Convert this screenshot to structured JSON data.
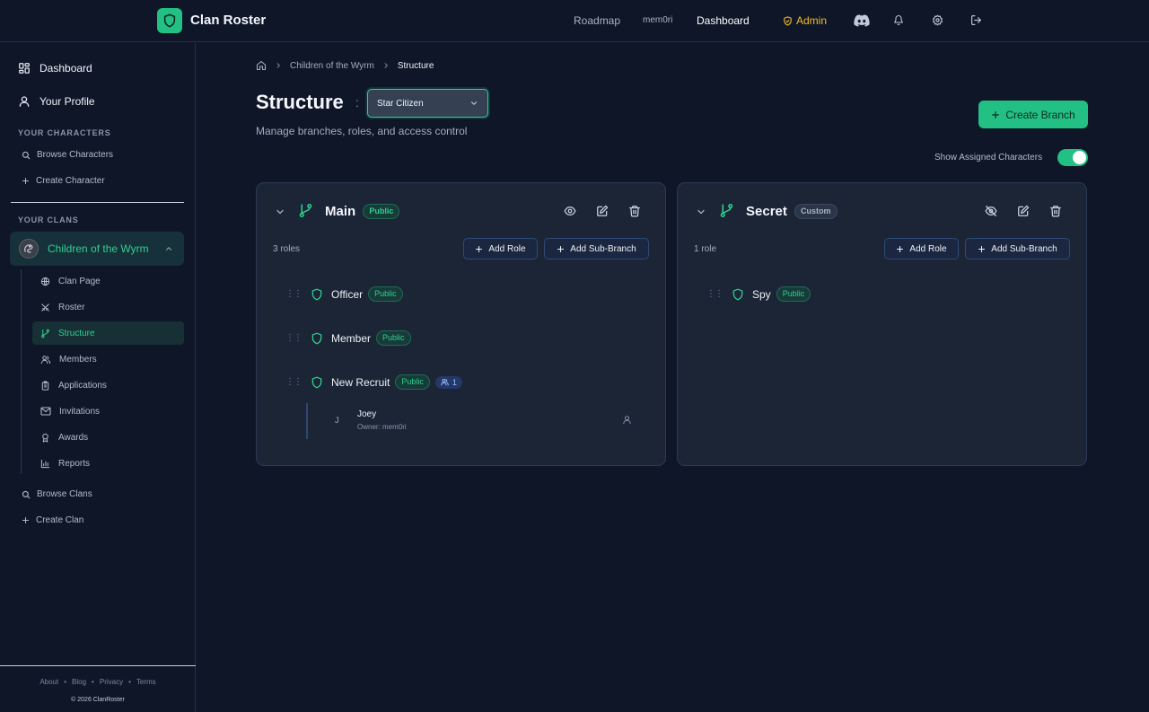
{
  "header": {
    "brand": "Clan Roster",
    "nav": {
      "roadmap": "Roadmap",
      "user": "mem0ri",
      "dashboard": "Dashboard",
      "admin": "Admin"
    },
    "icons": [
      "discord-icon",
      "bell-icon",
      "gear-icon",
      "logout-icon"
    ],
    "accent": "#22c083",
    "admin_color": "#f4bc2a"
  },
  "sidebar": {
    "dashboard": "Dashboard",
    "profile": "Your Profile",
    "characters_section": "YOUR CHARACTERS",
    "browse_characters": "Browse Characters",
    "create_character": "Create Character",
    "clans_section": "YOUR CLANS",
    "clan_name": "Children of the Wyrm",
    "clan_items": [
      "Clan Page",
      "Roster",
      "Structure",
      "Members",
      "Applications",
      "Invitations",
      "Awards",
      "Reports"
    ],
    "active_item": "Structure",
    "browse_clans": "Browse Clans",
    "create_clan": "Create Clan",
    "footer_links": [
      "About",
      "Blog",
      "Privacy",
      "Terms"
    ],
    "copyright": "© 2026 ClanRoster"
  },
  "breadcrumb": {
    "clan": "Children of the Wyrm",
    "current": "Structure"
  },
  "page": {
    "title": "Structure",
    "separator": ":",
    "game_select": "Star Citizen",
    "subtitle": "Manage branches, roles, and access control",
    "create_branch": "Create Branch",
    "toggle_label": "Show Assigned Characters",
    "toggle_on": true
  },
  "branches": [
    {
      "name": "Main",
      "visibility": "Public",
      "role_count": "3 roles",
      "add_role": "Add Role",
      "add_sub_branch": "Add Sub-Branch",
      "roles": [
        {
          "name": "Officer",
          "badge": "Public"
        },
        {
          "name": "Member",
          "badge": "Public"
        },
        {
          "name": "New Recruit",
          "badge": "Public",
          "member_count": "1"
        }
      ],
      "assigned": {
        "initial": "J",
        "name": "Joey",
        "owner": "Owner: mem0ri"
      }
    },
    {
      "name": "Secret",
      "visibility": "Custom",
      "role_count": "1 role",
      "add_role": "Add Role",
      "add_sub_branch": "Add Sub-Branch",
      "roles": [
        {
          "name": "Spy",
          "badge": "Public"
        }
      ]
    }
  ]
}
